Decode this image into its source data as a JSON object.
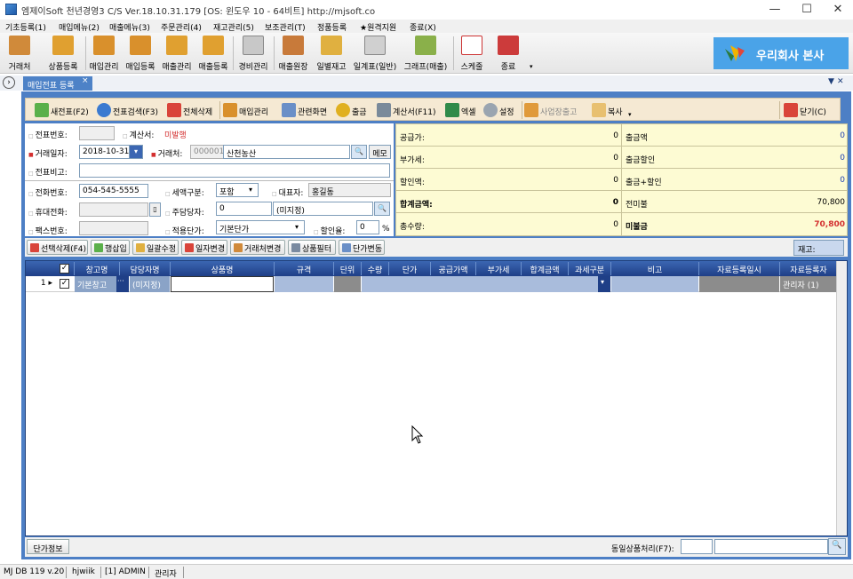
{
  "window": {
    "title": "엠제이Soft 천년경영3 C/S  Ver.18.10.31.179  [OS: 윈도우 10 - 64비트]  http://mjsoft.co"
  },
  "menu": [
    "기초등록(1)",
    "매입메뉴(2)",
    "매출메뉴(3)",
    "주문관리(4)",
    "재고관리(5)",
    "보조관리(T)",
    "정품등록",
    "★원격지원",
    "종료(X)"
  ],
  "toolbar": [
    "거래처",
    "상품등록",
    "매입관리",
    "매입등록",
    "매출관리",
    "매출등록",
    "경비관리",
    "매출원장",
    "일별재고",
    "일계표(일반)",
    "그래프(매출)",
    "스케줄",
    "종료"
  ],
  "brand": {
    "name": "우리회사 본사"
  },
  "tab": {
    "label": "매입전표 등록",
    "close": "×"
  },
  "doc_controls": "▼ ✕",
  "inner_toolbar": [
    "새전표(F2)",
    "전표검색(F3)",
    "전체삭제",
    "매입관리",
    "관련화면",
    "출금",
    "계산서(F11)",
    "엑셀",
    "설정",
    "사업장출고",
    "복사",
    "닫기(C)"
  ],
  "form": {
    "slip_no_label": "전표번호:",
    "slip_no": "",
    "invoice_label": "계산서:",
    "invoice_status": "미발행",
    "date_label": "거래일자:",
    "date": "2018-10-31",
    "customer_label": "거래처:",
    "customer_code": "000001",
    "customer_name": "산천농산",
    "memo_button": "메모",
    "note_label": "전표비고:",
    "note": "",
    "phone_label": "전화번호:",
    "phone": "054-545-5555",
    "tax_label": "세액구분:",
    "tax": "포함",
    "ceo_label": "대표자:",
    "ceo": "홍길동",
    "mobile_label": "휴대전화:",
    "mobile": "",
    "manager_label": "주담당자:",
    "manager_code": "0",
    "manager_name": "(미지정)",
    "fax_label": "팩스번호:",
    "fax": "",
    "price_label": "적용단가:",
    "price": "기본단가",
    "discount_label": "할인율:",
    "discount": "0",
    "percent": "%"
  },
  "summary": {
    "rows": [
      {
        "l1": "공급가:",
        "v1": "0",
        "l2": "출금액",
        "v2": "0"
      },
      {
        "l1": "부가세:",
        "v1": "0",
        "l2": "출금할인",
        "v2": "0"
      },
      {
        "l1": "할인액:",
        "v1": "0",
        "l2": "출금+할인",
        "v2": "0"
      },
      {
        "l1": "합계금액:",
        "v1": "0",
        "l2": "전미불",
        "v2": "70,800"
      },
      {
        "l1": "총수량:",
        "v1": "0",
        "l2": "미불금",
        "v2": "70,800"
      }
    ]
  },
  "actions": [
    "선택삭제(F4)",
    "행삽입",
    "일괄수정",
    "일자변경",
    "거래처변경",
    "상품필터",
    "단가변동"
  ],
  "stock_label": "재고:",
  "grid": {
    "headers": [
      "창고명",
      "담당자명",
      "상품명",
      "규격",
      "단위",
      "수량",
      "단가",
      "공급가액",
      "부가세",
      "합계금액",
      "과세구분",
      "비고",
      "자료등록일시",
      "자료등록자"
    ],
    "row": {
      "num": "1",
      "warehouse": "기본창고",
      "ellipsis": "···",
      "manager": "(미지정)",
      "registrant": "관리자 (1)"
    }
  },
  "bottom": {
    "price_info": "단가정보",
    "same_label": "동일상품처리(F7):"
  },
  "status": [
    "MJ DB 119 v.20",
    "hjwiik",
    "[1] ADMIN",
    "관리자"
  ]
}
